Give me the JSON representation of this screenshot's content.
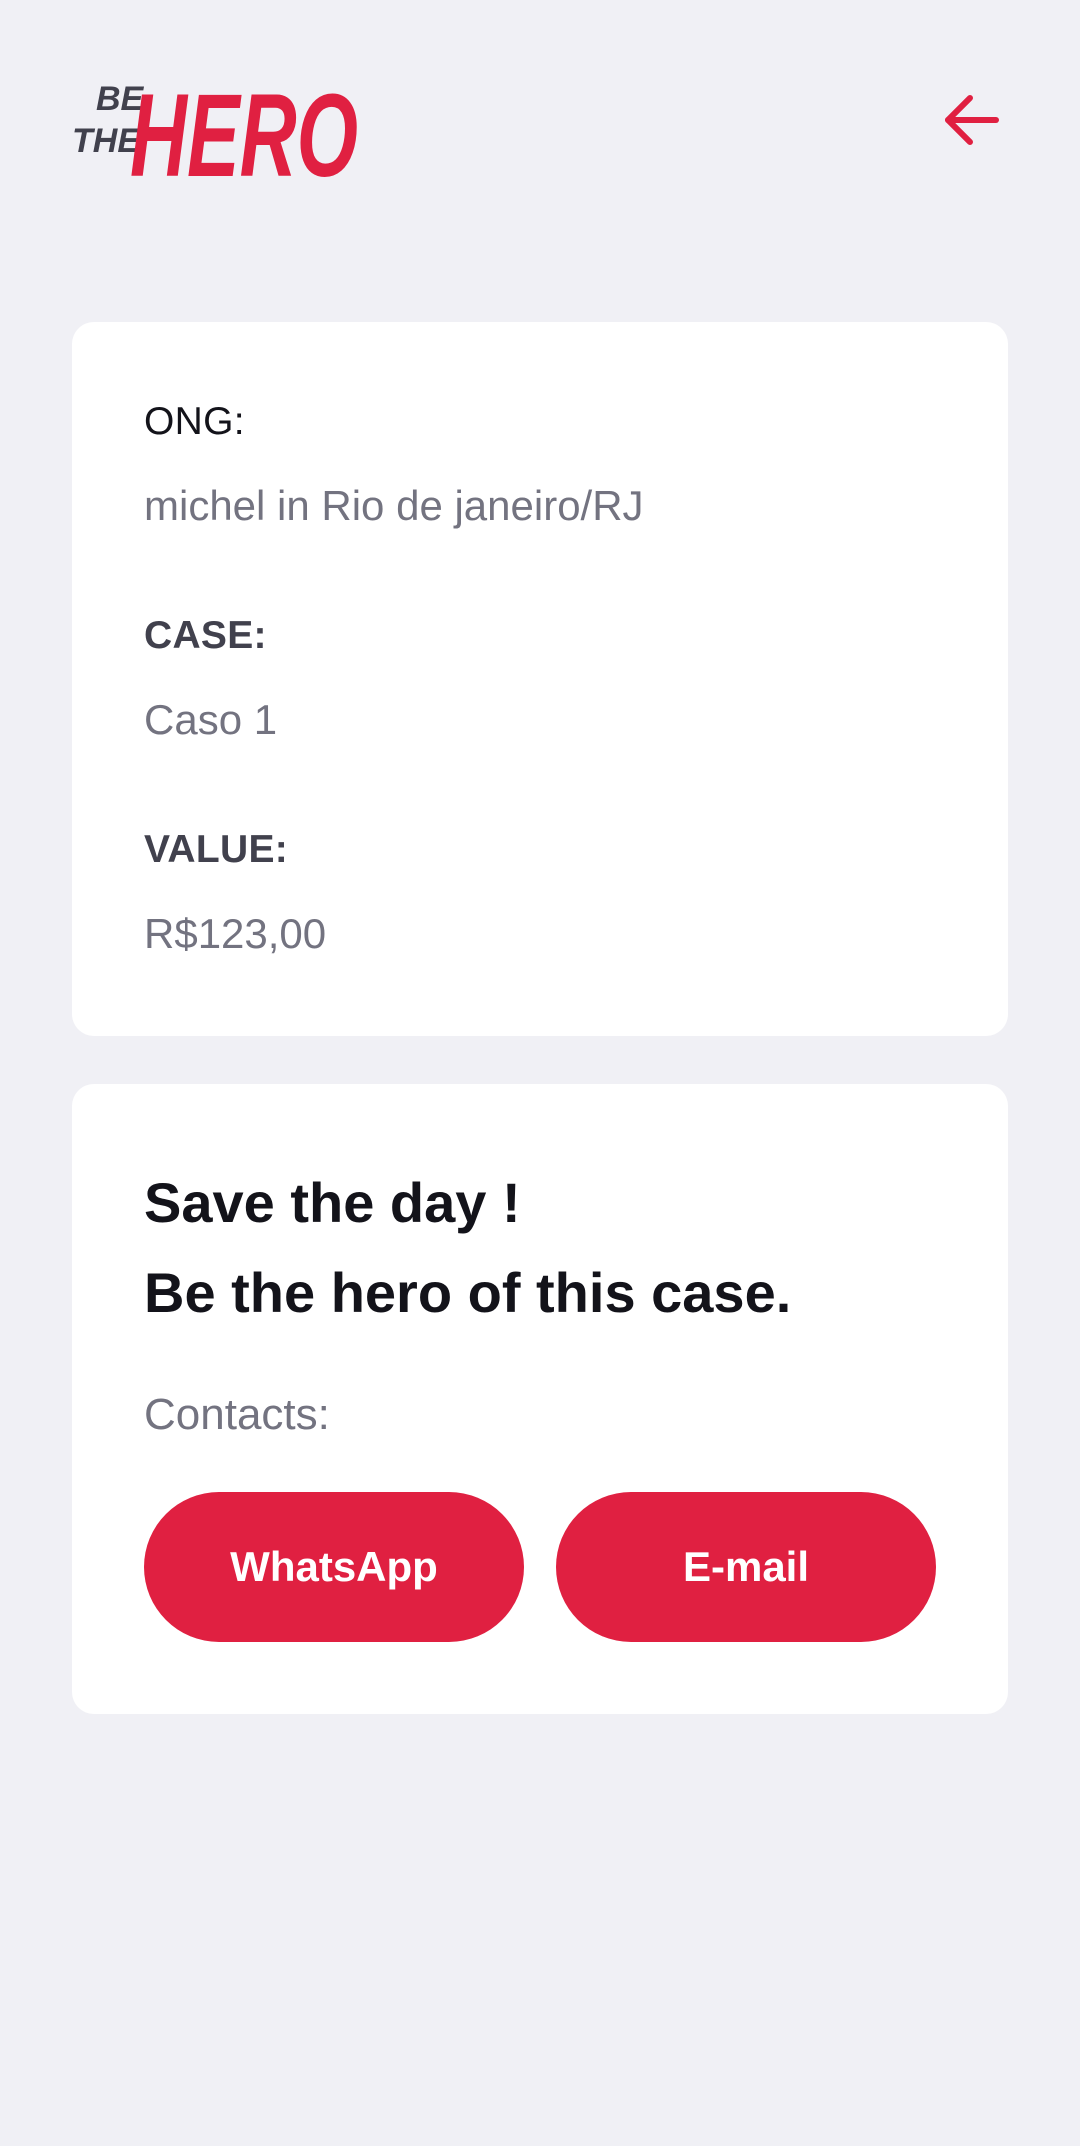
{
  "header": {
    "logo": {
      "line1": "BE",
      "line2": "THE",
      "brand": "HERO",
      "small_color": "#41414d",
      "brand_color": "#e02041"
    },
    "back_icon": "arrow-left-icon",
    "back_icon_color": "#e02041"
  },
  "incident": {
    "ong_label": "ONG:",
    "ong_value": "michel in Rio de janeiro/RJ",
    "case_label": "CASE:",
    "case_value": "Caso 1",
    "value_label": "VALUE:",
    "value_value": "R$123,00"
  },
  "contact": {
    "title_line1": "Save the day !",
    "title_line2": "Be the hero of this case.",
    "contacts_label": "Contacts:",
    "whatsapp_label": "WhatsApp",
    "email_label": "E-mail"
  },
  "colors": {
    "background": "#f0f0f5",
    "card": "#ffffff",
    "accent": "#e02041",
    "text_dark": "#13131a",
    "text_label": "#41414d",
    "text_muted": "#737380"
  }
}
